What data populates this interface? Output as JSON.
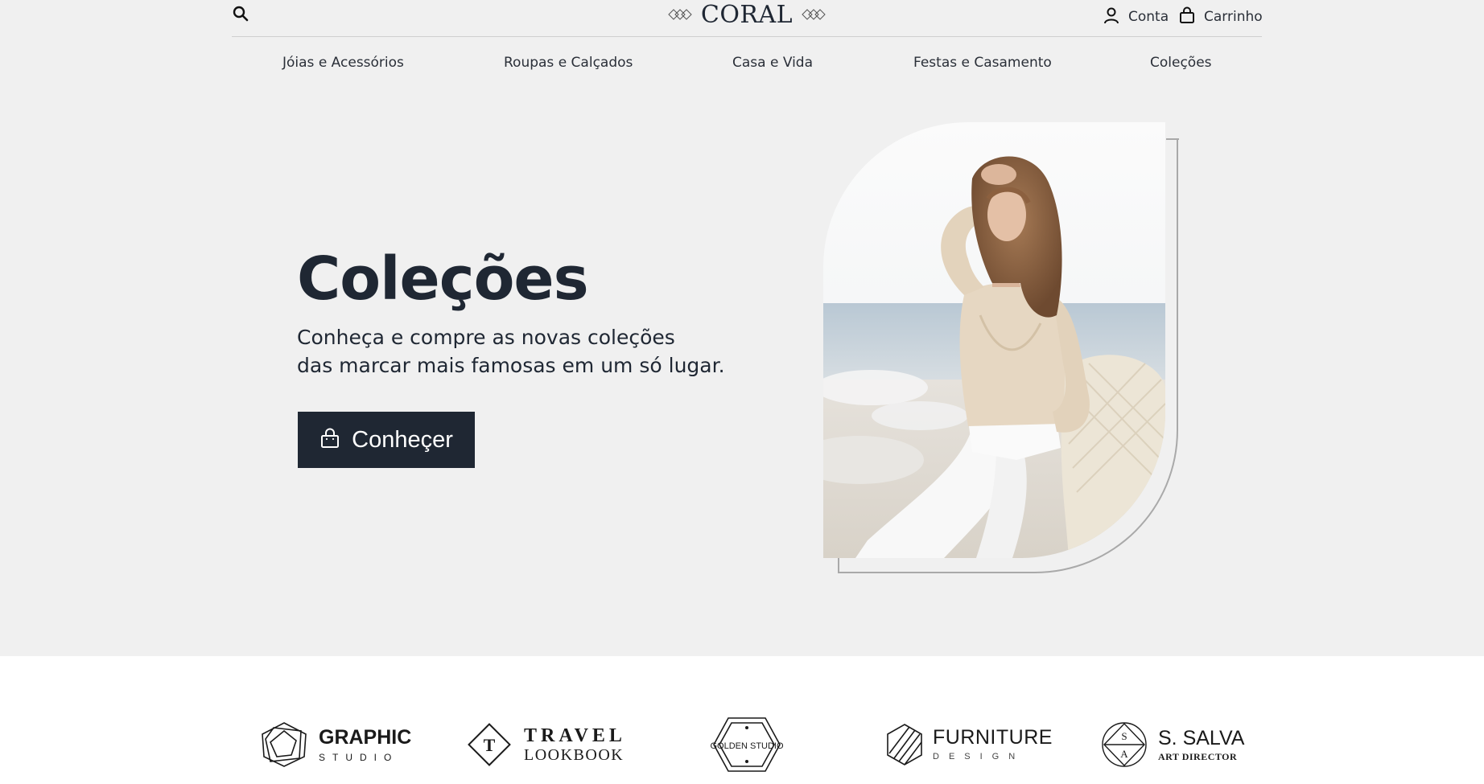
{
  "header": {
    "logo_text": "CORAL",
    "account_label": "Conta",
    "cart_label": "Carrinho"
  },
  "nav": {
    "items": [
      {
        "label": "Jóias e Acessórios"
      },
      {
        "label": "Roupas e Calçados"
      },
      {
        "label": "Casa e Vida"
      },
      {
        "label": "Festas e Casamento"
      },
      {
        "label": "Coleções"
      }
    ]
  },
  "hero": {
    "title": "Coleções",
    "subtitle_line1": "Conheça e compre as novas coleções",
    "subtitle_line2": "das marcar mais famosas em um só lugar.",
    "cta_label": "Conheçer",
    "image_subject": "woman in beige blouse and white trousers leaning on a wicker chair by the sea"
  },
  "brands": {
    "graphic_studio": {
      "main": "GRAPHIC",
      "sub": "STUDIO"
    },
    "travel_lookbook": {
      "badge": "T",
      "main": "TRAVEL",
      "sub": "LOOKBOOK"
    },
    "golden_studio": {
      "main": "GOLDEN STUDIO"
    },
    "furniture_design": {
      "main": "FURNITURE",
      "sub": "DESIGN"
    },
    "s_salva": {
      "badge_top": "S",
      "badge_bottom": "A",
      "main": "S. SALVA",
      "sub": "ART DIRECTOR"
    }
  },
  "colors": {
    "hero_bg": "#f0f0f0",
    "primary_dark": "#1f2733",
    "outline_gray": "#a9a9a9"
  },
  "icons": {
    "search": "search-icon",
    "account": "user-icon",
    "cart": "shopping-bag-icon"
  }
}
